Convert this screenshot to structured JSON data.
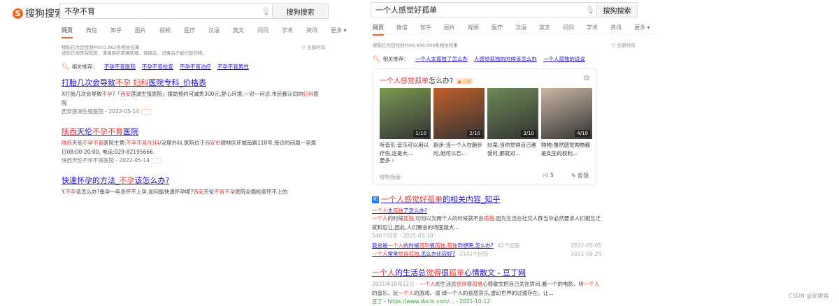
{
  "left": {
    "logo_text": "搜狗搜索",
    "query": "不孕不育",
    "search_button": "搜狗搜索",
    "tabs": [
      "网页",
      "微信",
      "知乎",
      "图片",
      "视频",
      "医疗",
      "汉语",
      "英文",
      "问问",
      "学术",
      "资讯",
      "更多 ▾"
    ],
    "result_count": "搜狗已为您找到约601,862条相关结果",
    "notice": "请到正规医院就医，谨慎用药需遵医嘱，保健品、消毒品不能代替药物。",
    "time_filter": "▽ 全部时间",
    "related_label": "相关推荐：",
    "related": [
      "不孕不育医院",
      "不孕不育检查",
      "不孕不育治疗",
      "不孕不育男性"
    ],
    "results": [
      {
        "title": [
          {
            "t": "打胎几次会导致"
          },
          {
            "t": "不孕",
            "hl": true
          },
          {
            "t": " "
          },
          {
            "t": "妇科",
            "hl": true
          },
          {
            "t": "医院专科_价格表"
          }
        ],
        "snippet": [
          {
            "t": "X打胎几次会导致"
          },
          {
            "t": "不孕",
            "hl": true
          },
          {
            "t": "?「"
          },
          {
            "t": "西安",
            "hl": true
          },
          {
            "t": "莲湖生殖医院」援助预约可减免300元,舒心环境,一对一问诊,市民都认同的"
          },
          {
            "t": "妇科",
            "hl": true
          },
          {
            "t": "医院"
          }
        ],
        "meta": "西安莲湖生殖医院 - 2022-05-14",
        "ad": true
      },
      {
        "title": [
          {
            "t": "陕西",
            "hl": true
          },
          {
            "t": "天伦"
          },
          {
            "t": "不孕不育",
            "hl": true
          },
          {
            "t": "医院"
          }
        ],
        "snippet": [
          {
            "t": "陕西",
            "hl": true
          },
          {
            "t": "天伦"
          },
          {
            "t": "不孕不育",
            "hl": true
          },
          {
            "t": "医院主营:"
          },
          {
            "t": "不孕不育/妇科",
            "hl": true
          },
          {
            "t": "/泌尿外科,医院位于"
          },
          {
            "t": "西安市",
            "hl": true
          },
          {
            "t": "碑林区环城南路118号,接诊时间周一至周日08:00-20:00, 电话:029-82195666."
          }
        ],
        "meta": "陕西天伦不孕不育医院 - 2022-05-14",
        "ad": true
      },
      {
        "title": [
          {
            "t": "快速怀孕的方法_"
          },
          {
            "t": "不孕",
            "hl": true
          },
          {
            "t": "该怎么办?"
          }
        ],
        "snippet": [
          {
            "t": "Y."
          },
          {
            "t": "不孕",
            "hl": true
          },
          {
            "t": "该怎么办?备孕一年多怀不上孕,如何能快速怀孕呢?"
          },
          {
            "t": "西安",
            "hl": true
          },
          {
            "t": "天伦"
          },
          {
            "t": "不育不孕",
            "hl": true
          },
          {
            "t": "医院全面检查怀不上的"
          }
        ],
        "meta": "",
        "ad": false
      }
    ]
  },
  "right": {
    "query": "一个人感觉好孤单",
    "search_button": "搜狗搜索",
    "tabs": [
      "网页",
      "微信",
      "知乎",
      "图片",
      "视频",
      "医疗",
      "汉语",
      "英文",
      "问问",
      "学术",
      "资讯",
      "更多 ▾"
    ],
    "result_count": "搜狗已为您找到约99,999,999条相关结果",
    "time_filter": "▽ 全部时间",
    "related_label": "相关推荐：",
    "related": [
      "一个人太孤独了怎么办",
      "人感觉孤独的时候该怎么办",
      "一个人孤独的说说"
    ],
    "card": {
      "title": [
        {
          "t": "一个人感觉孤单",
          "hl": true
        },
        {
          "t": "怎么办?"
        }
      ],
      "badge": "立刻",
      "items": [
        {
          "counter": "1/10",
          "caption": "听音乐:音乐可以用以疗伤,这是大...",
          "color": "#7a9a50"
        },
        {
          "counter": "2/10",
          "caption": "跑步:当一个人在跑步时,她可以忘...",
          "color": "#c0602a"
        },
        {
          "counter": "3/10",
          "caption": "炒菜:当你觉得自己难受时,那就对...",
          "color": "#6d8a55"
        },
        {
          "counter": "4/10",
          "caption": "购物:虽然感觉购物都是女生的权利...",
          "color": "#c9b7a4"
        }
      ],
      "more": "更多 ›",
      "source": "搜狗指南",
      "likes": "5",
      "feedback": "反馈"
    },
    "zhihu": {
      "icon_label": "知",
      "title": [
        {
          "t": "一个人感觉好孤单",
          "hl": true
        },
        {
          "t": "的相关内容_知乎"
        }
      ],
      "top_q": [
        {
          "t": "一个人",
          "hl": true
        },
        {
          "t": "太"
        },
        {
          "t": "孤独",
          "hl": true
        },
        {
          "t": "了怎么办?"
        }
      ],
      "snippet": [
        {
          "t": "一个人",
          "hl": true
        },
        {
          "t": "的时候"
        },
        {
          "t": "孤独",
          "hl": true
        },
        {
          "t": ",切勿以为两个人的时候就不会"
        },
        {
          "t": "孤独",
          "hl": true
        },
        {
          "t": ".因为生活在社交人群当中必然要求人们相互迁就和忍让,因此,人们聚会的场面越大..."
        }
      ],
      "top_meta": "546个回答 · 2015-03-30",
      "others": [
        {
          "q": [
            {
              "t": "我总是"
            },
            {
              "t": "一个人",
              "hl": true
            },
            {
              "t": "的时候"
            },
            {
              "t": "感到",
              "hl": true
            },
            {
              "t": "很"
            },
            {
              "t": "孤独",
              "hl": true
            },
            {
              "t": ","
            },
            {
              "t": "孤独",
              "hl": true
            },
            {
              "t": "到想哭,怎么办?"
            }
          ],
          "answers": "42个回答",
          "date": "2022-05-05"
        },
        {
          "q": [
            {
              "t": "一个人",
              "hl": true
            },
            {
              "t": "常常"
            },
            {
              "t": "觉得孤独",
              "hl": true
            },
            {
              "t": ",怎么办比较好?"
            }
          ],
          "answers": "2142个回答",
          "date": "2021-06-29"
        }
      ]
    },
    "docin": {
      "title": [
        {
          "t": "一个人",
          "hl": true
        },
        {
          "t": "的生活总"
        },
        {
          "t": "觉得",
          "hl": true
        },
        {
          "t": "很"
        },
        {
          "t": "孤单",
          "hl": true
        },
        {
          "t": "心情散文 - 豆丁网"
        }
      ],
      "snippet": [
        {
          "t": "2021年10月12日 - ",
          "gray": true
        },
        {
          "t": "一个人",
          "hl": true
        },
        {
          "t": "的生活总"
        },
        {
          "t": "觉得",
          "hl": true
        },
        {
          "t": "很"
        },
        {
          "t": "孤单",
          "hl": true
        },
        {
          "t": "心情散文把自己关在房间,看一个的电影、听"
        },
        {
          "t": "一个人",
          "hl": true
        },
        {
          "t": "的音乐、玩"
        },
        {
          "t": "一个人",
          "hl": true
        },
        {
          "t": "的游戏、演 绎一个人的喜怒哀乐,虚幻世界的过渡存在。让..."
        }
      ],
      "meta": "豆丁  -  https://www.docin.com/...  - 2021-10-12"
    }
  },
  "watermark": "CSDN @安陵容"
}
